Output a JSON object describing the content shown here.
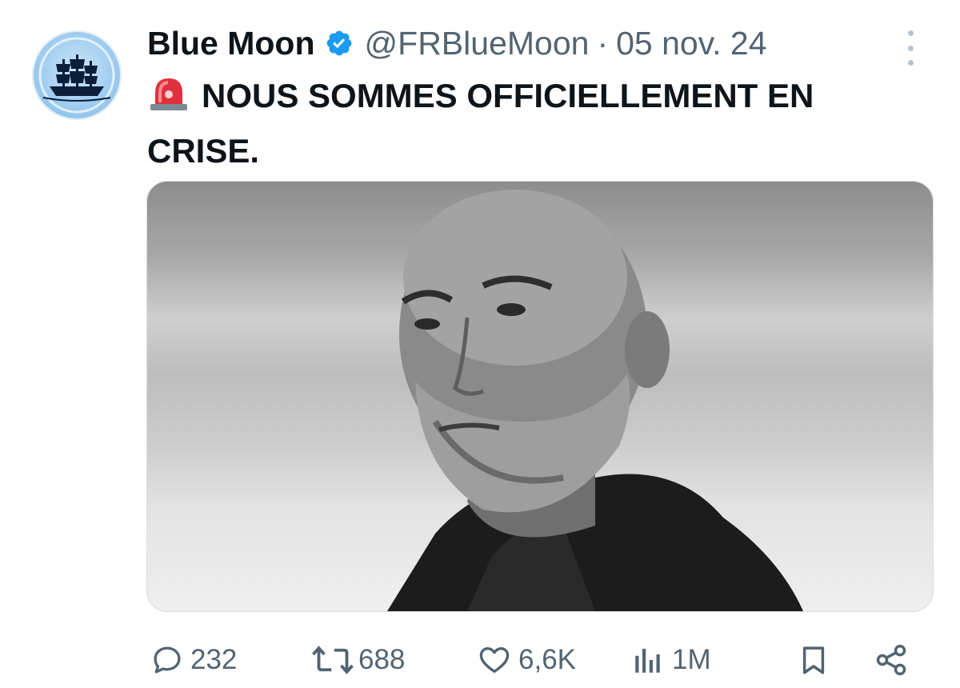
{
  "tweet": {
    "author_name": "Blue Moon",
    "handle": "@FRBlueMoon",
    "separator": "·",
    "date": "05 nov. 24",
    "text": "NOUS SOMMES OFFICIELLEMENT EN CRISE.",
    "emoji_icon": "rotating-light-icon",
    "media_icon": "photo"
  },
  "actions": {
    "replies": "232",
    "retweets": "688",
    "likes": "6,6K",
    "views": "1M"
  },
  "colors": {
    "text": "#0f1419",
    "secondary": "#536471",
    "verified": "#1d9bf0",
    "avatar_blue": "#9fcdf0"
  }
}
